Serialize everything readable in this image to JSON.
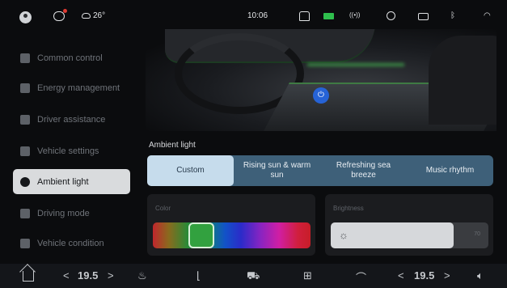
{
  "status_bar": {
    "temperature": "26°",
    "time": "10:06",
    "icons": [
      "avatar-icon",
      "message-icon",
      "cloud-icon",
      "car-icon",
      "battery-icon",
      "signal-icon",
      "location-icon",
      "camera-icon",
      "bluetooth-icon",
      "wifi-icon"
    ]
  },
  "sidebar": {
    "items": [
      {
        "label": "Common control",
        "icon": "grid-icon"
      },
      {
        "label": "Energy management",
        "icon": "battery-icon"
      },
      {
        "label": "Driver assistance",
        "icon": "car-icon"
      },
      {
        "label": "Vehicle settings",
        "icon": "settings-icon"
      },
      {
        "label": "Ambient light",
        "icon": "sun-icon",
        "active": true
      },
      {
        "label": "Driving mode",
        "icon": "steering-icon"
      },
      {
        "label": "Vehicle condition",
        "icon": "diagnostics-icon"
      }
    ]
  },
  "main": {
    "section_label": "Ambient light",
    "modes": [
      {
        "label": "Custom",
        "active": true
      },
      {
        "label": "Rising sun & warm sun"
      },
      {
        "label": "Refreshing sea breeze"
      },
      {
        "label": "Music rhythm"
      }
    ],
    "color": {
      "title": "Color",
      "selected": "#32a13f",
      "picker_position": 0.27
    },
    "brightness": {
      "title": "Brightness",
      "value": "70",
      "level": 0.78
    }
  },
  "bottom_bar": {
    "left_temp": "19.5",
    "right_temp": "19.5",
    "left_arrow": "<",
    "right_arrow": ">",
    "icons": [
      "home-icon",
      "defrost-icon",
      "seat-icon",
      "car-front-icon",
      "apps-icon",
      "car-side-icon",
      "volume-icon"
    ]
  },
  "colors": {
    "accent_tab": "#3e6079",
    "active_tab": "#c6dcec",
    "power_button": "#2663d6",
    "battery": "#2fbf4d"
  }
}
